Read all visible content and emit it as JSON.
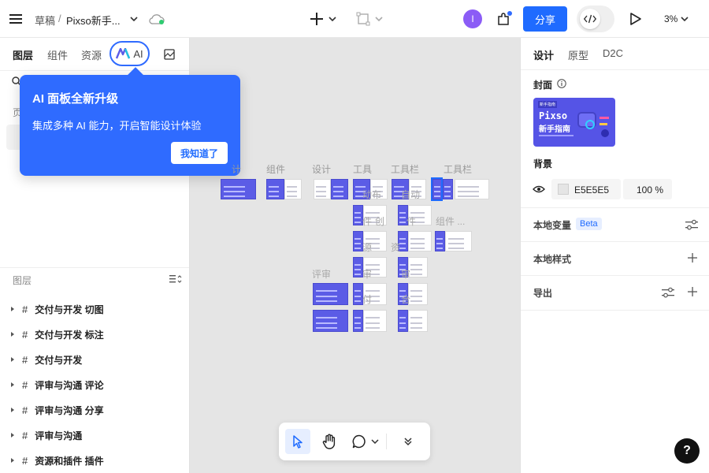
{
  "header": {
    "breadcrumb_drafts": "草稿",
    "breadcrumb_sep": "/",
    "file_name": "Pixso新手...",
    "avatar_letter": "I",
    "share_label": "分享",
    "zoom": "3%"
  },
  "left_tabs": {
    "layers": "图层",
    "components": "组件",
    "assets": "资源",
    "ai": "AI"
  },
  "pages": {
    "heading": "页"
  },
  "popup": {
    "title": "AI 面板全新升级",
    "body": "集成多种 AI 能力，开启智能设计体验",
    "button": "我知道了"
  },
  "layers_panel": {
    "heading": "图层",
    "items": [
      "交付与开发 切图",
      "交付与开发 标注",
      "交付与开发",
      "评审与沟通 评论",
      "评审与沟通 分享",
      "评审与沟通",
      "资源和插件 插件"
    ]
  },
  "canvas": {
    "row_labels": [
      "计",
      "组件",
      "设计",
      "工具",
      "工具栏",
      "工具栏"
    ],
    "overlay_labels": [
      "动布",
      "自动",
      "组件 ...",
      "件",
      "创",
      "件",
      "评审",
      "审",
      "审",
      "付",
      "合",
      "源",
      "资"
    ]
  },
  "right_panel": {
    "tabs": {
      "design": "设计",
      "prototype": "原型",
      "d2c": "D2C"
    },
    "cover_label": "封面",
    "cover_thumb": {
      "badge": "新手指南",
      "brand": "Pixso",
      "title": "新手指南"
    },
    "background_label": "背景",
    "bg_hex": "E5E5E5",
    "bg_opacity": "100 %",
    "local_variables": "本地变量",
    "beta": "Beta",
    "local_styles": "本地样式",
    "export": "导出"
  },
  "help": "?",
  "colors": {
    "accent": "#1f6bff",
    "popup_bg": "#2f6bff",
    "avatar": "#8b5cf6",
    "canvas": "#E5E5E5"
  }
}
